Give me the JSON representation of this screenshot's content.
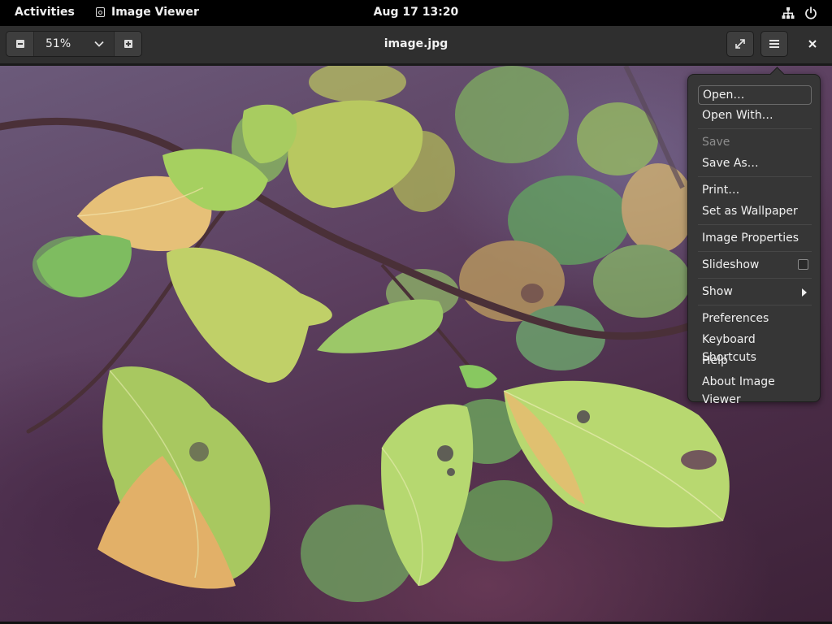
{
  "topbar": {
    "activities": "Activities",
    "app_name": "Image Viewer",
    "clock_date": "Aug 17",
    "clock_time": "13:20"
  },
  "header": {
    "zoom_value": "51%",
    "title": "image.jpg"
  },
  "menu": {
    "open": "Open…",
    "open_with": "Open With…",
    "save": "Save",
    "save_as": "Save As…",
    "print": "Print…",
    "set_wallpaper": "Set as Wallpaper",
    "image_properties": "Image Properties",
    "slideshow": "Slideshow",
    "show": "Show",
    "preferences": "Preferences",
    "keyboard_shortcuts": "Keyboard Shortcuts",
    "help": "Help",
    "about": "About Image Viewer",
    "slideshow_checked": false,
    "save_enabled": false
  },
  "image": {
    "subject": "autumn leaves on a branch"
  },
  "colors": {
    "topbar": "#000000",
    "headerbar": "#2f2f2f",
    "popover": "#363636",
    "text": "#f0f0f0",
    "disabled_text": "#8d8d8d"
  }
}
